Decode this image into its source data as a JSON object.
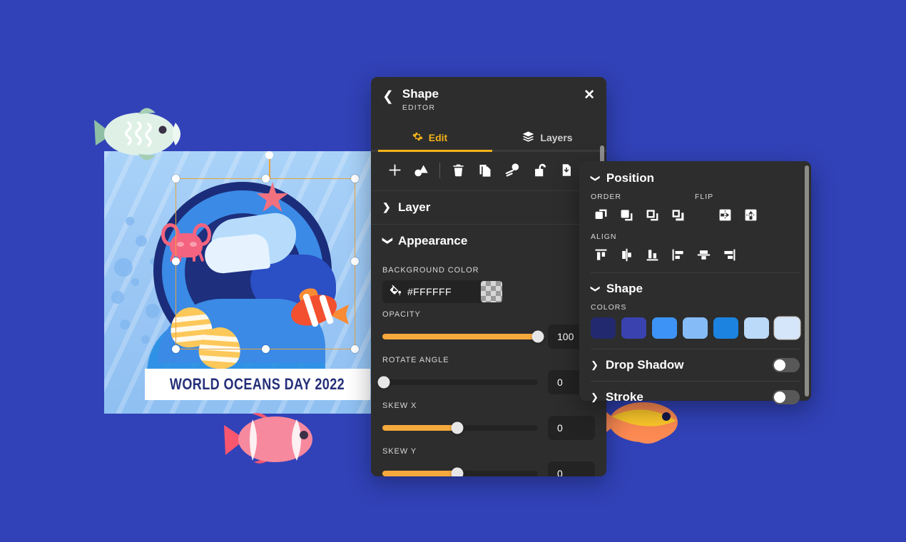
{
  "background_color": "#3142b8",
  "canvas": {
    "name": "design-canvas",
    "banner_text": "WORLD OCEANS DAY 2022",
    "banner_color": "#FFFFFF",
    "banner_text_color": "#25307A",
    "selection_color": "#E8A33A"
  },
  "shape_panel": {
    "title": "Shape",
    "subtitle": "EDITOR",
    "back_icon": "chevron-left-icon",
    "close_icon": "close-icon",
    "tabs": [
      {
        "label": "Edit",
        "icon": "gear-icon",
        "active": true
      },
      {
        "label": "Layers",
        "icon": "layers-icon",
        "active": false
      }
    ],
    "toolbar": [
      {
        "name": "add-icon",
        "title": "Add"
      },
      {
        "name": "shapes-icon",
        "title": "Shapes"
      },
      {
        "name": "trash-icon",
        "title": "Delete"
      },
      {
        "name": "duplicate-icon",
        "title": "Duplicate"
      },
      {
        "name": "eyedropper-icon",
        "title": "Pick color"
      },
      {
        "name": "unlock-icon",
        "title": "Lock"
      },
      {
        "name": "download-file-icon",
        "title": "Download"
      }
    ],
    "sections": {
      "layer": {
        "label": "Layer",
        "expanded": false,
        "caret": "chevron-right-icon"
      },
      "appearance": {
        "label": "Appearance",
        "expanded": true,
        "caret": "chevron-down-icon",
        "background_color": {
          "label": "BACKGROUND COLOR",
          "value": "#FFFFFF",
          "icon": "paint-bucket-icon"
        },
        "opacity": {
          "label": "OPACITY",
          "value": "100",
          "percent": 100
        },
        "rotate_angle": {
          "label": "ROTATE ANGLE",
          "value": "0",
          "percent": 0
        },
        "skew_x": {
          "label": "SKEW X",
          "value": "0",
          "percent": 43
        },
        "skew_y": {
          "label": "SKEW Y",
          "value": "0",
          "percent": 43
        }
      }
    },
    "accent_color": "#F2B21A",
    "slider_color": "#F5A93C"
  },
  "position_panel": {
    "position": {
      "label": "Position",
      "expanded": true,
      "caret": "chevron-down-icon",
      "order": {
        "label": "ORDER",
        "buttons": [
          "bring-to-front-icon",
          "bring-forward-icon",
          "send-backward-icon",
          "send-to-back-icon"
        ]
      },
      "flip": {
        "label": "FLIP",
        "buttons": [
          "flip-horizontal-icon",
          "flip-vertical-icon"
        ]
      },
      "align": {
        "label": "ALIGN",
        "buttons": [
          "align-top-icon",
          "align-center-vertical-icon",
          "align-bottom-icon",
          "align-left-icon",
          "align-center-horizontal-icon",
          "align-right-icon"
        ]
      }
    },
    "shape": {
      "label": "Shape",
      "expanded": true,
      "caret": "chevron-down-icon",
      "colors_label": "COLORS",
      "colors": [
        "#23296E",
        "#3A42B0",
        "#3D94F6",
        "#85BCF7",
        "#1C84E0",
        "#BBD9F8",
        "#D6E6FA"
      ]
    },
    "drop_shadow": {
      "label": "Drop Shadow",
      "caret": "chevron-right-icon",
      "enabled": false
    },
    "stroke": {
      "label": "Stroke",
      "caret": "chevron-right-icon",
      "enabled": false
    }
  }
}
